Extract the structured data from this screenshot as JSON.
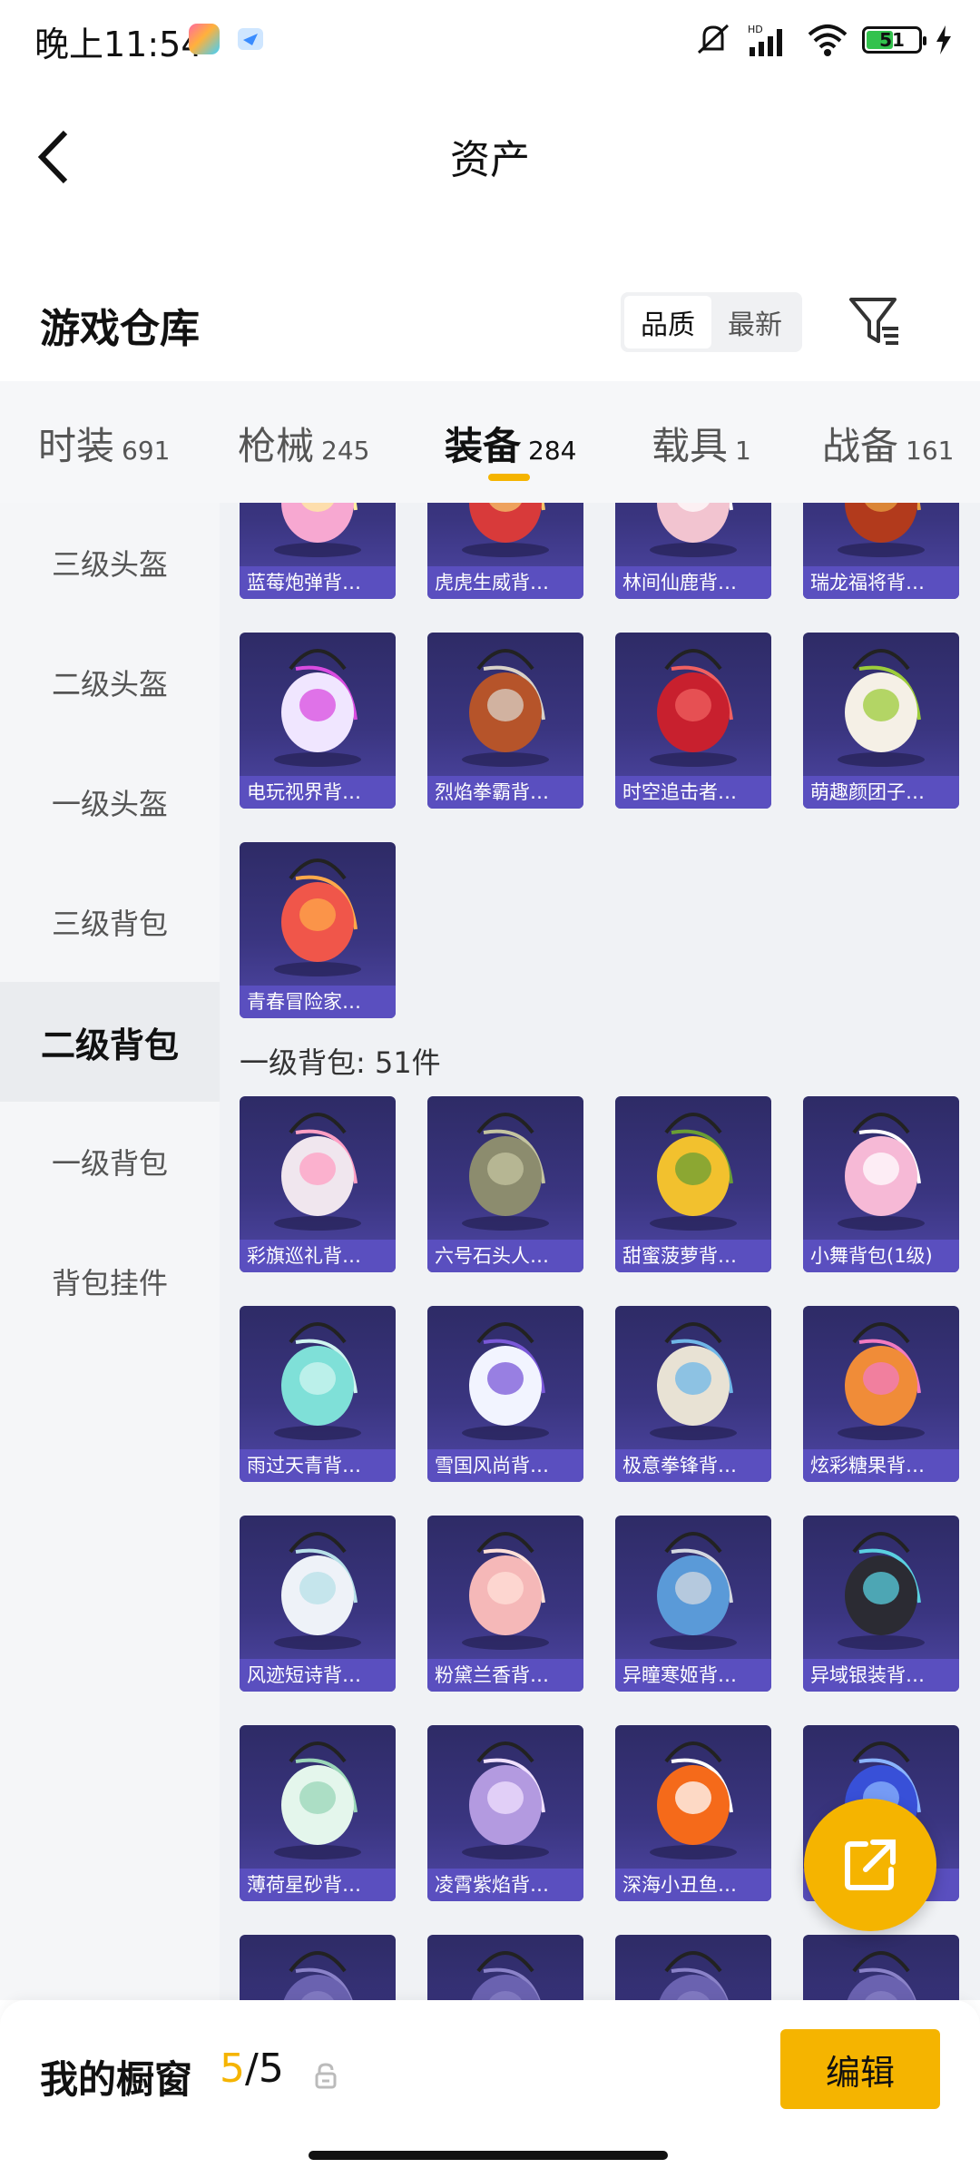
{
  "status_bar": {
    "time": "晚上11:54",
    "battery": "51"
  },
  "header": {
    "title": "资产"
  },
  "section": {
    "title": "游戏仓库",
    "sort_options": [
      "品质",
      "最新"
    ],
    "active_sort": "品质"
  },
  "category_tabs": [
    {
      "label": "时装",
      "count": "691"
    },
    {
      "label": "枪械",
      "count": "245"
    },
    {
      "label": "装备",
      "count": "284",
      "active": true
    },
    {
      "label": "载具",
      "count": "1"
    },
    {
      "label": "战备",
      "count": "161"
    }
  ],
  "sidebar": {
    "items": [
      "三级头盔",
      "二级头盔",
      "一级头盔",
      "三级背包",
      "二级背包",
      "一级背包",
      "背包挂件"
    ],
    "active": "二级背包"
  },
  "group_label": "一级背包: 51件",
  "items_level2": [
    {
      "name": "蓝莓炮弹背…",
      "icon": "pink-cake-backpack"
    },
    {
      "name": "虎虎生威背…",
      "icon": "red-tiger-backpack"
    },
    {
      "name": "林间仙鹿背…",
      "icon": "deer-backpack"
    },
    {
      "name": "瑞龙福将背…",
      "icon": "dragon-backpack"
    },
    {
      "name": "电玩视界背…",
      "icon": "arcade-backpack"
    },
    {
      "name": "烈焰拳霸背…",
      "icon": "flame-fist-backpack"
    },
    {
      "name": "时空追击者…",
      "icon": "red-mech-backpack"
    },
    {
      "name": "萌趣颜团子…",
      "icon": "bunny-plush-backpack"
    },
    {
      "name": "青春冒险家…",
      "icon": "orange-dino-backpack"
    }
  ],
  "items_level1": [
    {
      "name": "彩旗巡礼背…",
      "icon": "flag-pouch"
    },
    {
      "name": "六号石头人…",
      "icon": "stone-man-pouch"
    },
    {
      "name": "甜蜜菠萝背…",
      "icon": "pineapple-backpack"
    },
    {
      "name": "小舞背包(1级)",
      "icon": "pink-bunny-pouch"
    },
    {
      "name": "雨过天青背…",
      "icon": "teal-pouch"
    },
    {
      "name": "雪国风尚背…",
      "icon": "snow-penguin-backpack"
    },
    {
      "name": "极意拳锋背…",
      "icon": "box-backpack"
    },
    {
      "name": "炫彩糖果背…",
      "icon": "donut-backpack"
    },
    {
      "name": "风迹短诗背…",
      "icon": "white-satchel"
    },
    {
      "name": "粉黛兰香背…",
      "icon": "peach-pouch"
    },
    {
      "name": "异瞳寒姬背…",
      "icon": "blue-mech-backpack"
    },
    {
      "name": "异域银装背…",
      "icon": "black-vest-backpack"
    },
    {
      "name": "薄荷星砂背…",
      "icon": "mint-bag"
    },
    {
      "name": "凌霄紫焰背…",
      "icon": "purple-pouch"
    },
    {
      "name": "深海小丑鱼…",
      "icon": "clownfish-backpack"
    },
    {
      "name": "",
      "icon": "blue-orb-backpack"
    },
    {
      "name": "",
      "icon": "partial-item"
    },
    {
      "name": "",
      "icon": "partial-item"
    },
    {
      "name": "",
      "icon": "partial-item"
    },
    {
      "name": "",
      "icon": "partial-item"
    }
  ],
  "bottom_bar": {
    "label": "我的橱窗",
    "count_current": "5",
    "count_sep": "/5",
    "edit_label": "编辑"
  },
  "colors": {
    "accent": "#f5b400",
    "card_bg": "#3a3580",
    "card_label": "#5a4fbf"
  }
}
